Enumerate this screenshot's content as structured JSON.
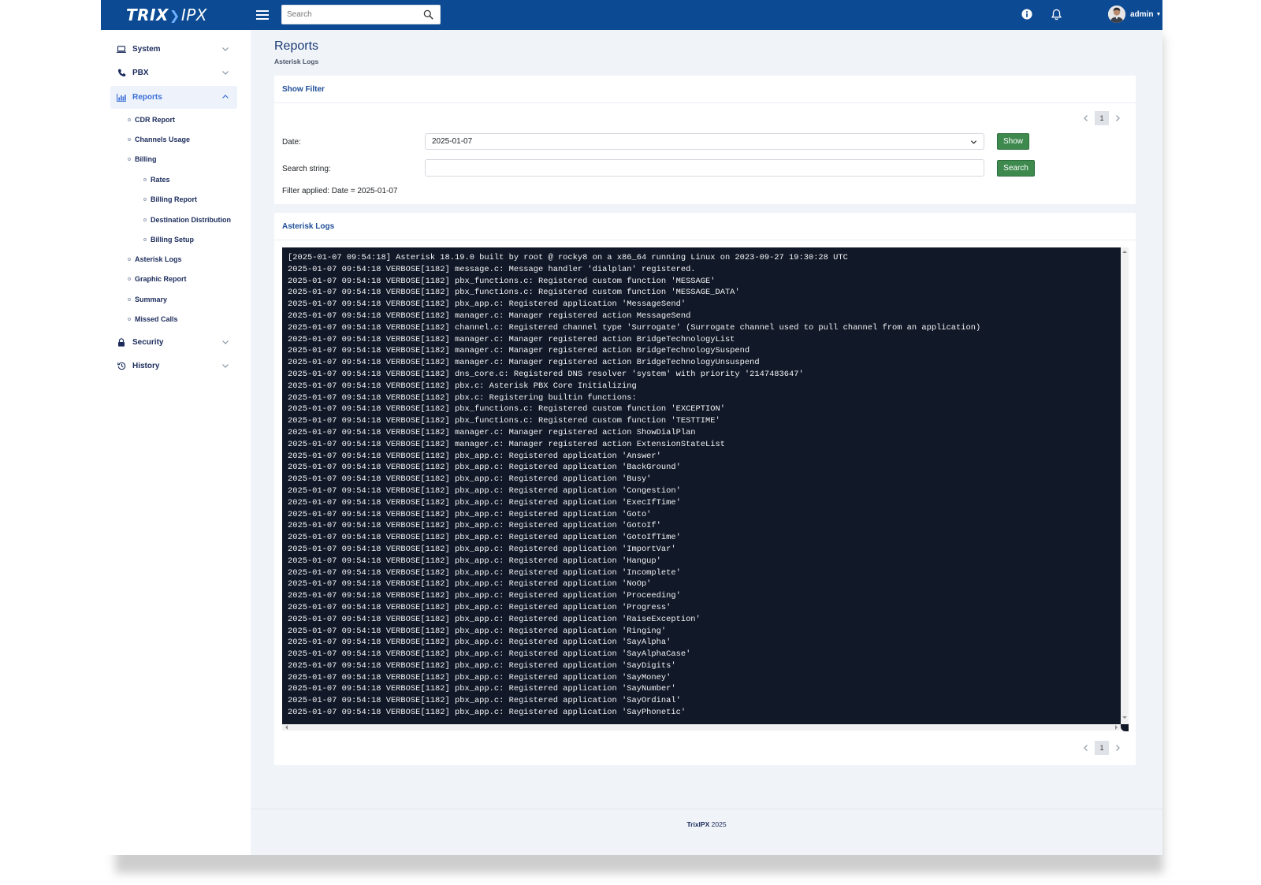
{
  "app": {
    "logo_left": "TRIX",
    "logo_right": "IPX",
    "search_placeholder": "Search",
    "user_name": "admin"
  },
  "sidebar": {
    "items": [
      {
        "label": "System",
        "icon": "laptop-icon"
      },
      {
        "label": "PBX",
        "icon": "phone-icon"
      },
      {
        "label": "Reports",
        "icon": "bar-chart-icon",
        "expanded": true
      },
      {
        "label": "Security",
        "icon": "lock-icon"
      },
      {
        "label": "History",
        "icon": "history-icon"
      }
    ],
    "reports_sub": [
      "CDR Report",
      "Channels Usage",
      "Billing",
      "Asterisk Logs",
      "Graphic Report",
      "Summary",
      "Missed Calls"
    ],
    "billing_sub": [
      "Rates",
      "Billing Report",
      "Destination Distribution",
      "Billing Setup"
    ]
  },
  "page": {
    "title": "Reports",
    "breadcrumb": "Asterisk Logs"
  },
  "filter": {
    "header": "Show Filter",
    "page_number": "1",
    "date_label": "Date:",
    "date_value": "2025-01-07",
    "show_label": "Show",
    "search_label": "Search string:",
    "search_value": "",
    "search_button": "Search",
    "applied_text": "Filter applied: Date = 2025-01-07"
  },
  "logs": {
    "header": "Asterisk Logs",
    "page_number": "1",
    "lines": [
      "[2025-01-07 09:54:18] Asterisk 18.19.0 built by root @ rocky8 on a x86_64 running Linux on 2023-09-27 19:30:28 UTC",
      "2025-01-07 09:54:18 VERBOSE[1182] message.c: Message handler 'dialplan' registered.",
      "2025-01-07 09:54:18 VERBOSE[1182] pbx_functions.c: Registered custom function 'MESSAGE'",
      "2025-01-07 09:54:18 VERBOSE[1182] pbx_functions.c: Registered custom function 'MESSAGE_DATA'",
      "2025-01-07 09:54:18 VERBOSE[1182] pbx_app.c: Registered application 'MessageSend'",
      "2025-01-07 09:54:18 VERBOSE[1182] manager.c: Manager registered action MessageSend",
      "2025-01-07 09:54:18 VERBOSE[1182] channel.c: Registered channel type 'Surrogate' (Surrogate channel used to pull channel from an application)",
      "2025-01-07 09:54:18 VERBOSE[1182] manager.c: Manager registered action BridgeTechnologyList",
      "2025-01-07 09:54:18 VERBOSE[1182] manager.c: Manager registered action BridgeTechnologySuspend",
      "2025-01-07 09:54:18 VERBOSE[1182] manager.c: Manager registered action BridgeTechnologyUnsuspend",
      "2025-01-07 09:54:18 VERBOSE[1182] dns_core.c: Registered DNS resolver 'system' with priority '2147483647'",
      "2025-01-07 09:54:18 VERBOSE[1182] pbx.c: Asterisk PBX Core Initializing",
      "2025-01-07 09:54:18 VERBOSE[1182] pbx.c: Registering builtin functions:",
      "2025-01-07 09:54:18 VERBOSE[1182] pbx_functions.c: Registered custom function 'EXCEPTION'",
      "2025-01-07 09:54:18 VERBOSE[1182] pbx_functions.c: Registered custom function 'TESTTIME'",
      "2025-01-07 09:54:18 VERBOSE[1182] manager.c: Manager registered action ShowDialPlan",
      "2025-01-07 09:54:18 VERBOSE[1182] manager.c: Manager registered action ExtensionStateList",
      "2025-01-07 09:54:18 VERBOSE[1182] pbx_app.c: Registered application 'Answer'",
      "2025-01-07 09:54:18 VERBOSE[1182] pbx_app.c: Registered application 'BackGround'",
      "2025-01-07 09:54:18 VERBOSE[1182] pbx_app.c: Registered application 'Busy'",
      "2025-01-07 09:54:18 VERBOSE[1182] pbx_app.c: Registered application 'Congestion'",
      "2025-01-07 09:54:18 VERBOSE[1182] pbx_app.c: Registered application 'ExecIfTime'",
      "2025-01-07 09:54:18 VERBOSE[1182] pbx_app.c: Registered application 'Goto'",
      "2025-01-07 09:54:18 VERBOSE[1182] pbx_app.c: Registered application 'GotoIf'",
      "2025-01-07 09:54:18 VERBOSE[1182] pbx_app.c: Registered application 'GotoIfTime'",
      "2025-01-07 09:54:18 VERBOSE[1182] pbx_app.c: Registered application 'ImportVar'",
      "2025-01-07 09:54:18 VERBOSE[1182] pbx_app.c: Registered application 'Hangup'",
      "2025-01-07 09:54:18 VERBOSE[1182] pbx_app.c: Registered application 'Incomplete'",
      "2025-01-07 09:54:18 VERBOSE[1182] pbx_app.c: Registered application 'NoOp'",
      "2025-01-07 09:54:18 VERBOSE[1182] pbx_app.c: Registered application 'Proceeding'",
      "2025-01-07 09:54:18 VERBOSE[1182] pbx_app.c: Registered application 'Progress'",
      "2025-01-07 09:54:18 VERBOSE[1182] pbx_app.c: Registered application 'RaiseException'",
      "2025-01-07 09:54:18 VERBOSE[1182] pbx_app.c: Registered application 'Ringing'",
      "2025-01-07 09:54:18 VERBOSE[1182] pbx_app.c: Registered application 'SayAlpha'",
      "2025-01-07 09:54:18 VERBOSE[1182] pbx_app.c: Registered application 'SayAlphaCase'",
      "2025-01-07 09:54:18 VERBOSE[1182] pbx_app.c: Registered application 'SayDigits'",
      "2025-01-07 09:54:18 VERBOSE[1182] pbx_app.c: Registered application 'SayMoney'",
      "2025-01-07 09:54:18 VERBOSE[1182] pbx_app.c: Registered application 'SayNumber'",
      "2025-01-07 09:54:18 VERBOSE[1182] pbx_app.c: Registered application 'SayOrdinal'",
      "2025-01-07 09:54:18 VERBOSE[1182] pbx_app.c: Registered application 'SayPhonetic'"
    ]
  },
  "footer": {
    "brand": "TrixIPX",
    "year": "2025"
  },
  "colors": {
    "topbar": "#0c4a93",
    "terminal_bg": "#111827",
    "button_green": "#3e8a4e",
    "active_nav": "#3b6fd8"
  }
}
